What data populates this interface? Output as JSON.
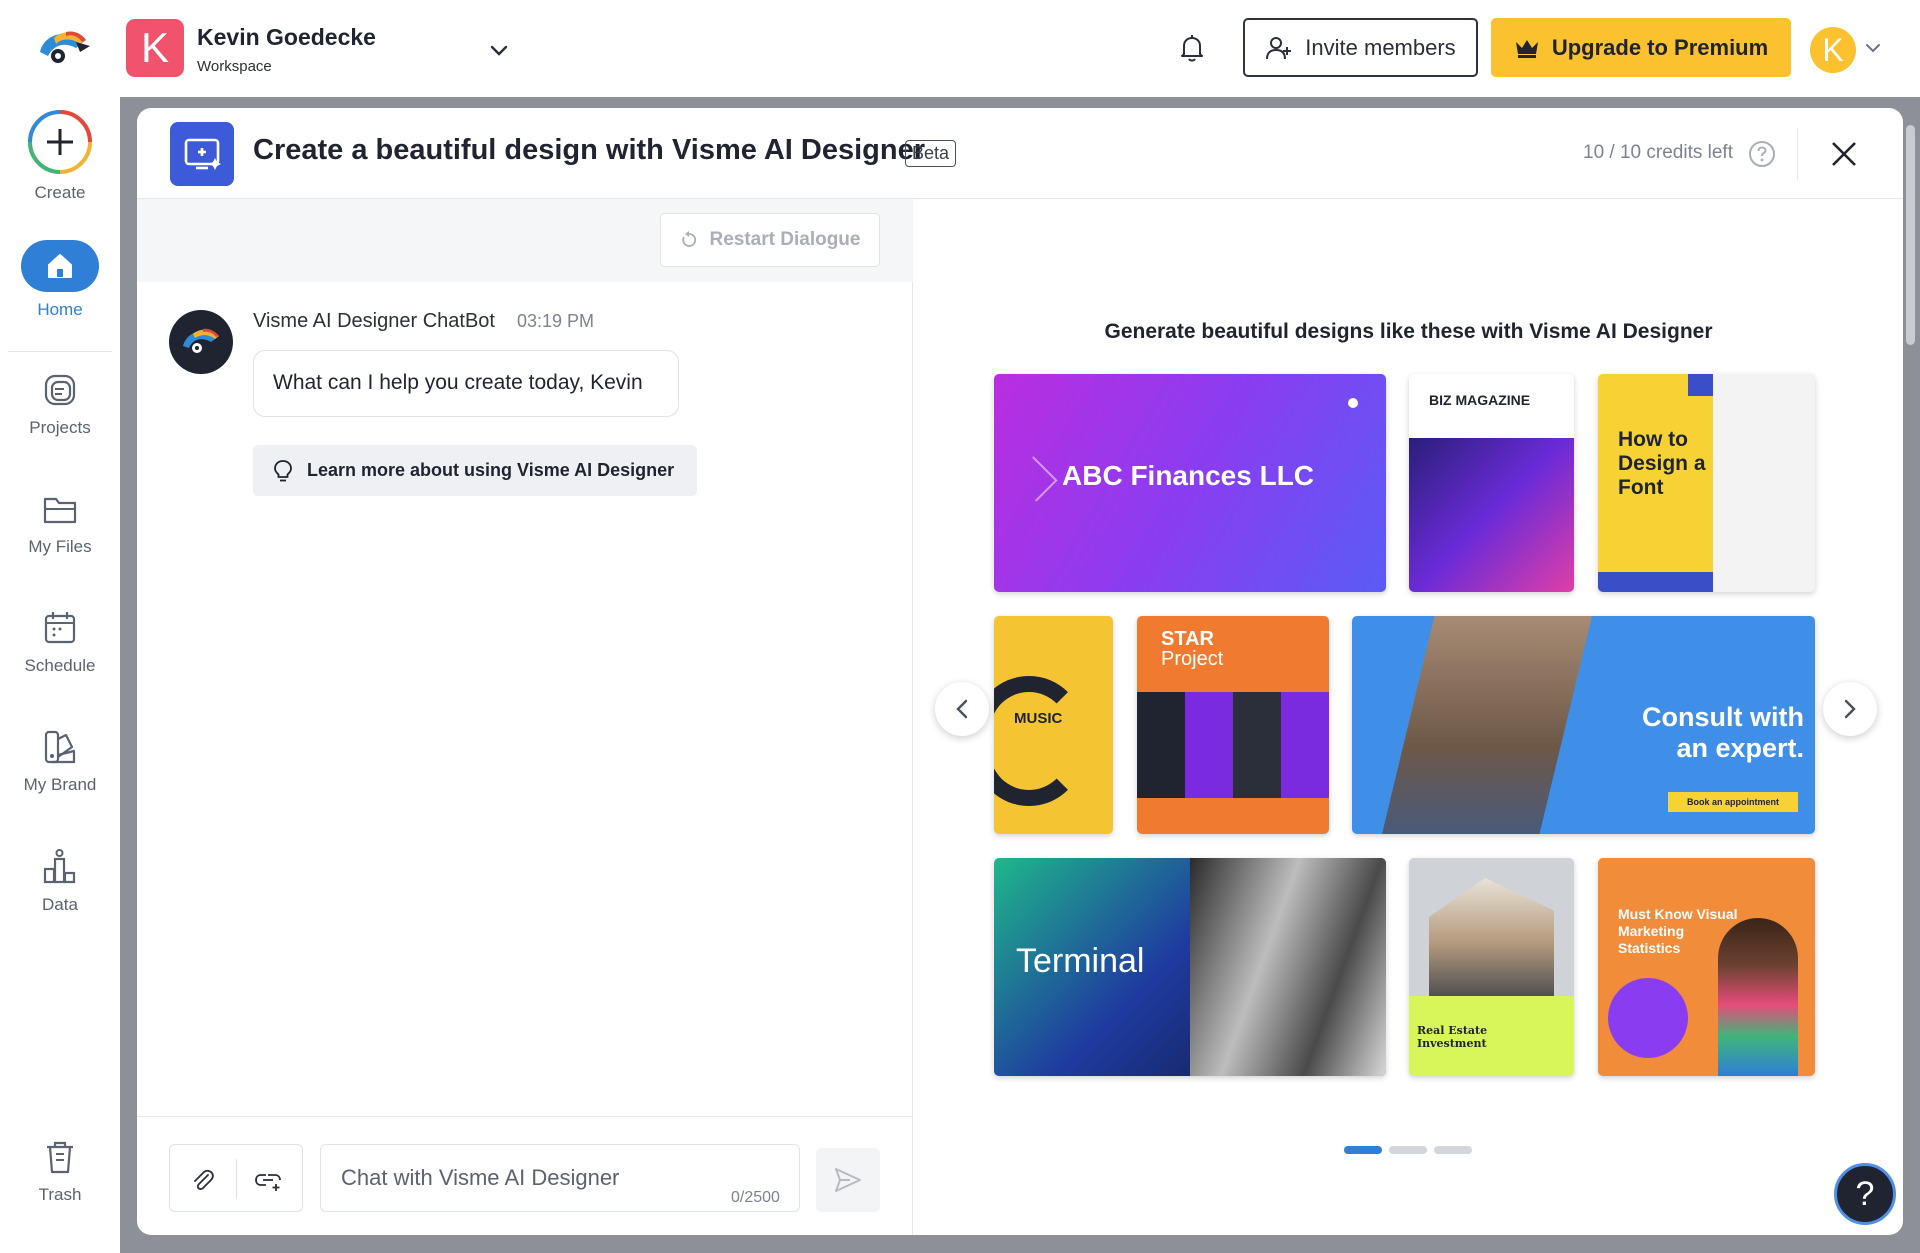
{
  "header": {
    "workspace_initial": "K",
    "workspace_name": "Kevin Goedecke",
    "workspace_subtitle": "Workspace",
    "invite_label": "Invite members",
    "upgrade_label": "Upgrade to Premium",
    "user_initial": "K"
  },
  "sidebar": {
    "create": "Create",
    "home": "Home",
    "projects": "Projects",
    "my_files": "My Files",
    "schedule": "Schedule",
    "my_brand": "My Brand",
    "data": "Data",
    "trash": "Trash"
  },
  "modal": {
    "title": "Create a beautiful design with Visme AI Designer",
    "badge": "Beta",
    "credits": "10 / 10 credits left"
  },
  "chat": {
    "restart_label": "Restart Dialogue",
    "bot_name": "Visme AI Designer ChatBot",
    "time": "03:19 PM",
    "message": "What can I help you create today, Kevin",
    "learn_label": "Learn more about using Visme AI Designer",
    "input_placeholder": "Chat with Visme AI Designer",
    "char_count": "0/2500"
  },
  "gallery": {
    "title": "Generate beautiful designs like these with Visme AI Designer",
    "tiles": {
      "abc": "ABC Finances LLC",
      "biz": "BIZ MAGAZINE",
      "font": "How to Design a Font",
      "music": "MUSIC",
      "star_1": "STAR",
      "star_2": "Project",
      "consult": "Consult with an expert.",
      "book": "Book an appointment",
      "terminal": "Terminal",
      "realestate": "Real Estate Investment",
      "marketing": "Must Know Visual Marketing Statistics"
    }
  },
  "help_fab": "?",
  "colors": {
    "accent_blue": "#3d5bd9",
    "premium_yellow": "#fbc12e",
    "home_blue": "#2f7fd6",
    "workspace_pink": "#f0536b"
  }
}
